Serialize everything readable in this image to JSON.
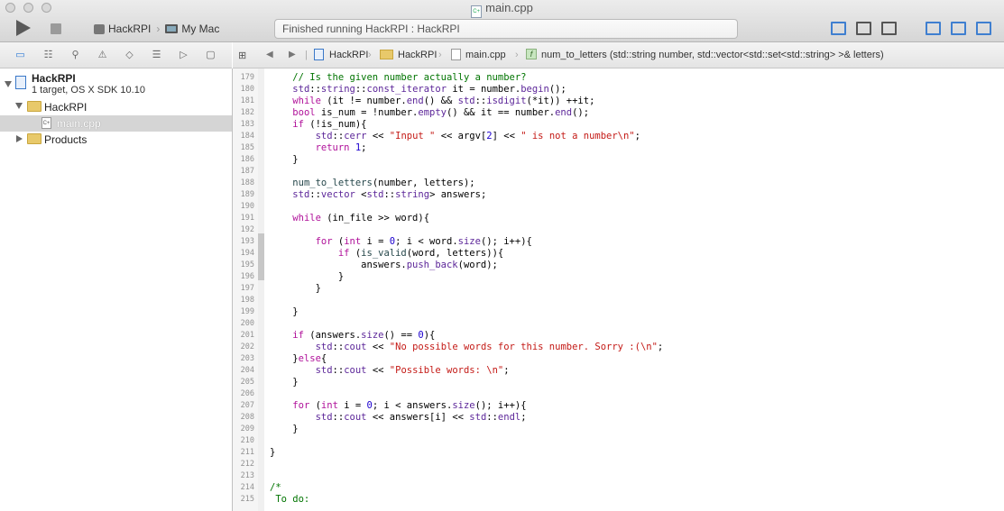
{
  "window": {
    "title": "main.cpp",
    "scheme_project": "HackRPI",
    "scheme_destination": "My Mac",
    "status_text": "Finished running HackRPI : HackRPI"
  },
  "navigator": {
    "project_name": "HackRPI",
    "project_subtitle": "1 target, OS X SDK 10.10",
    "group_name": "HackRPI",
    "selected_file": "main.cpp",
    "products_group": "Products"
  },
  "jumpbar": {
    "project": "HackRPI",
    "folder": "HackRPI",
    "file": "main.cpp",
    "function": "num_to_letters (std::string number, std::vector<std::set<std::string> >& letters)"
  },
  "editor": {
    "lines": [
      {
        "n": "179",
        "html": "    <span class=\"c-cmt\">// Is the given number actually a number?</span>"
      },
      {
        "n": "180",
        "html": "    <span class=\"c-typ\">std</span>::<span class=\"c-typ\">string</span>::<span class=\"c-typ\">const_iterator</span> it = number.<span class=\"c-typ\">begin</span>();"
      },
      {
        "n": "181",
        "html": "    <span class=\"c-kw\">while</span> (it != number.<span class=\"c-typ\">end</span>() &amp;&amp; <span class=\"c-typ\">std</span>::<span class=\"c-typ\">isdigit</span>(*it)) ++it;"
      },
      {
        "n": "182",
        "html": "    <span class=\"c-kw\">bool</span> is_num = !number.<span class=\"c-typ\">empty</span>() &amp;&amp; it == number.<span class=\"c-typ\">end</span>();"
      },
      {
        "n": "183",
        "html": "    <span class=\"c-kw\">if</span> (!is_num){"
      },
      {
        "n": "184",
        "html": "        <span class=\"c-typ\">std</span>::<span class=\"c-typ\">cerr</span> &lt;&lt; <span class=\"c-str\">\"Input \"</span> &lt;&lt; argv[<span class=\"c-num\">2</span>] &lt;&lt; <span class=\"c-str\">\" is not a number\\n\"</span>;"
      },
      {
        "n": "185",
        "html": "        <span class=\"c-kw\">return</span> <span class=\"c-num\">1</span>;"
      },
      {
        "n": "186",
        "html": "    }"
      },
      {
        "n": "187",
        "html": ""
      },
      {
        "n": "188",
        "html": "    <span class=\"c-fn\">num_to_letters</span>(number, letters);"
      },
      {
        "n": "189",
        "html": "    <span class=\"c-typ\">std</span>::<span class=\"c-typ\">vector</span> &lt;<span class=\"c-typ\">std</span>::<span class=\"c-typ\">string</span>&gt; answers;"
      },
      {
        "n": "190",
        "html": ""
      },
      {
        "n": "191",
        "html": "    <span class=\"c-kw\">while</span> (in_file &gt;&gt; word){"
      },
      {
        "n": "192",
        "html": ""
      },
      {
        "n": "193",
        "html": "        <span class=\"c-kw\">for</span> (<span class=\"c-kw\">int</span> i = <span class=\"c-num\">0</span>; i &lt; word.<span class=\"c-typ\">size</span>(); i++){"
      },
      {
        "n": "194",
        "html": "            <span class=\"c-kw\">if</span> (<span class=\"c-fn\">is_valid</span>(word, letters)){"
      },
      {
        "n": "195",
        "html": "                answers.<span class=\"c-typ\">push_back</span>(word);"
      },
      {
        "n": "196",
        "html": "            }"
      },
      {
        "n": "197",
        "html": "        }"
      },
      {
        "n": "198",
        "html": ""
      },
      {
        "n": "199",
        "html": "    }"
      },
      {
        "n": "200",
        "html": ""
      },
      {
        "n": "201",
        "html": "    <span class=\"c-kw\">if</span> (answers.<span class=\"c-typ\">size</span>() == <span class=\"c-num\">0</span>){"
      },
      {
        "n": "202",
        "html": "        <span class=\"c-typ\">std</span>::<span class=\"c-typ\">cout</span> &lt;&lt; <span class=\"c-str\">\"No possible words for this number. Sorry :(\\n\"</span>;"
      },
      {
        "n": "203",
        "html": "    }<span class=\"c-kw\">else</span>{"
      },
      {
        "n": "204",
        "html": "        <span class=\"c-typ\">std</span>::<span class=\"c-typ\">cout</span> &lt;&lt; <span class=\"c-str\">\"Possible words: \\n\"</span>;"
      },
      {
        "n": "205",
        "html": "    }"
      },
      {
        "n": "206",
        "html": ""
      },
      {
        "n": "207",
        "html": "    <span class=\"c-kw\">for</span> (<span class=\"c-kw\">int</span> i = <span class=\"c-num\">0</span>; i &lt; answers.<span class=\"c-typ\">size</span>(); i++){"
      },
      {
        "n": "208",
        "html": "        <span class=\"c-typ\">std</span>::<span class=\"c-typ\">cout</span> &lt;&lt; answers[i] &lt;&lt; <span class=\"c-typ\">std</span>::<span class=\"c-typ\">endl</span>;"
      },
      {
        "n": "209",
        "html": "    }"
      },
      {
        "n": "210",
        "html": ""
      },
      {
        "n": "211",
        "html": "}"
      },
      {
        "n": "212",
        "html": ""
      },
      {
        "n": "213",
        "html": ""
      },
      {
        "n": "214",
        "html": "<span class=\"c-cmt\">/*</span>"
      },
      {
        "n": "215",
        "html": "<span class=\"c-cmt\"> To do:</span>"
      }
    ]
  }
}
